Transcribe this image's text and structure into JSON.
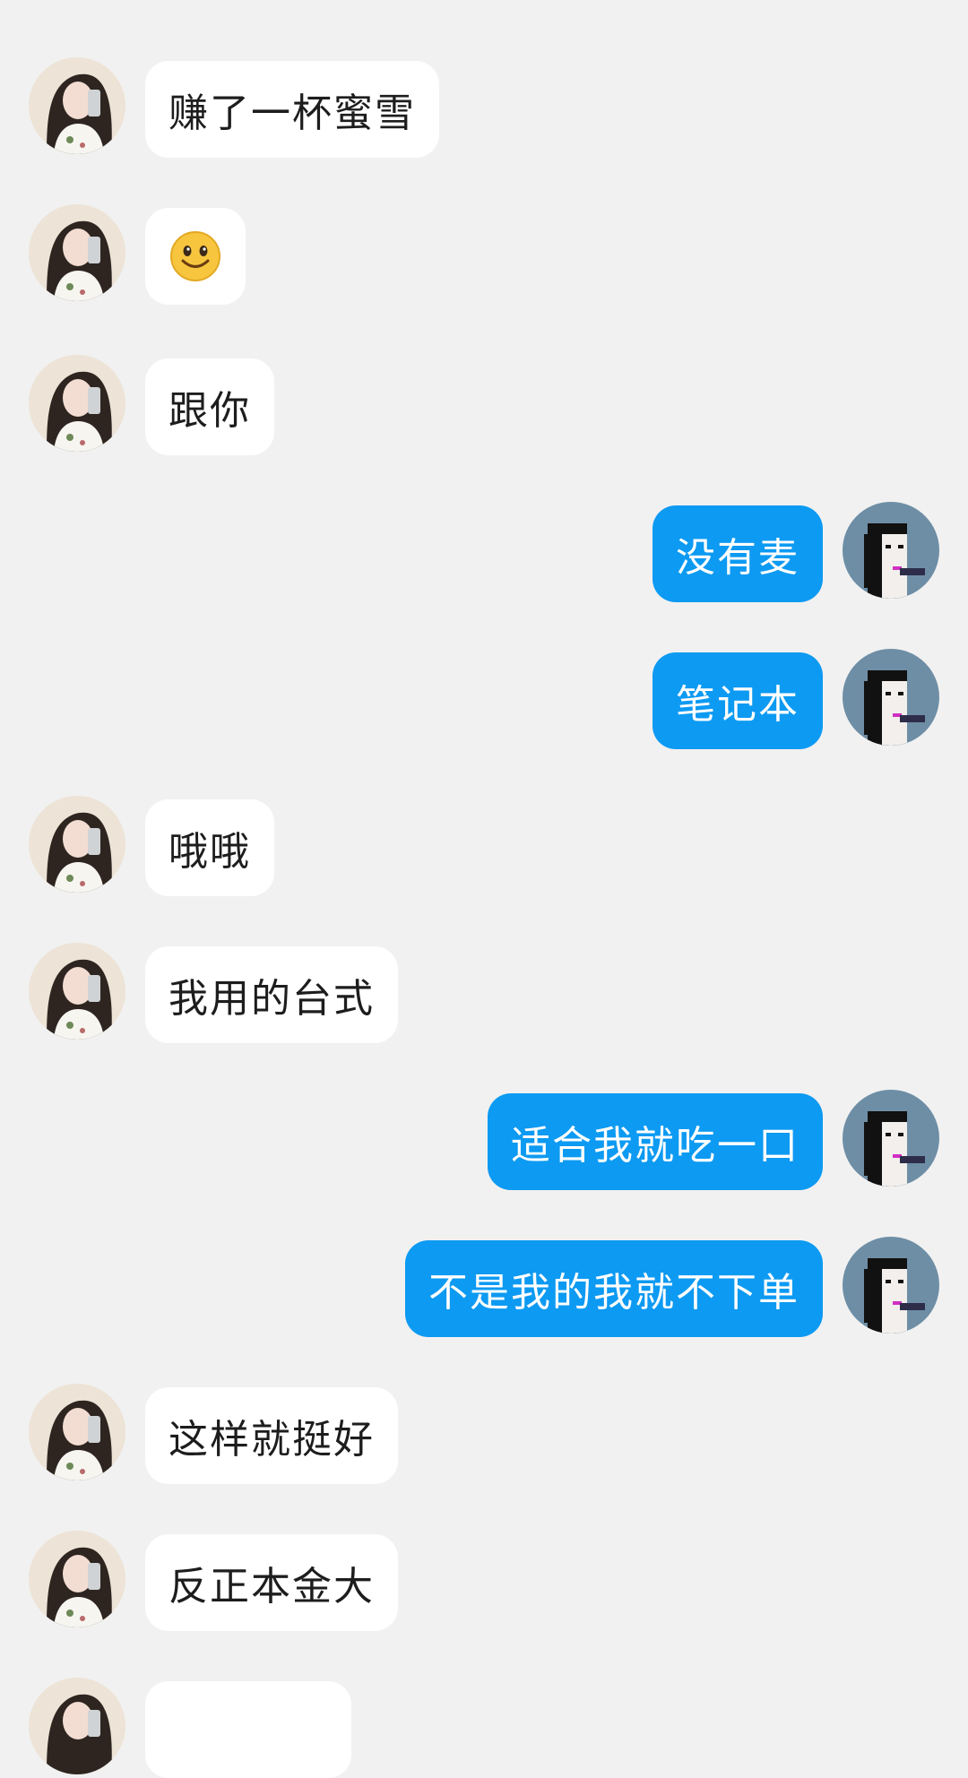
{
  "top_partial_text": "",
  "colors": {
    "background": "#f1f1f1",
    "incoming_bubble": "#ffffff",
    "outgoing_bubble": "#0d9af2",
    "incoming_text": "#1d1d1d",
    "outgoing_text": "#ffffff"
  },
  "messages": [
    {
      "side": "left",
      "text": "赚了一杯蜜雪"
    },
    {
      "side": "left",
      "emoji": "smile-emoji"
    },
    {
      "side": "left",
      "text": "跟你"
    },
    {
      "side": "right",
      "text": "没有麦"
    },
    {
      "side": "right",
      "text": "笔记本"
    },
    {
      "side": "left",
      "text": "哦哦"
    },
    {
      "side": "left",
      "text": "我用的台式"
    },
    {
      "side": "right",
      "text": "适合我就吃一口"
    },
    {
      "side": "right",
      "text": "不是我的我就不下单"
    },
    {
      "side": "left",
      "text": "这样就挺好"
    },
    {
      "side": "left",
      "text": "反正本金大"
    },
    {
      "side": "left",
      "text": ""
    }
  ]
}
